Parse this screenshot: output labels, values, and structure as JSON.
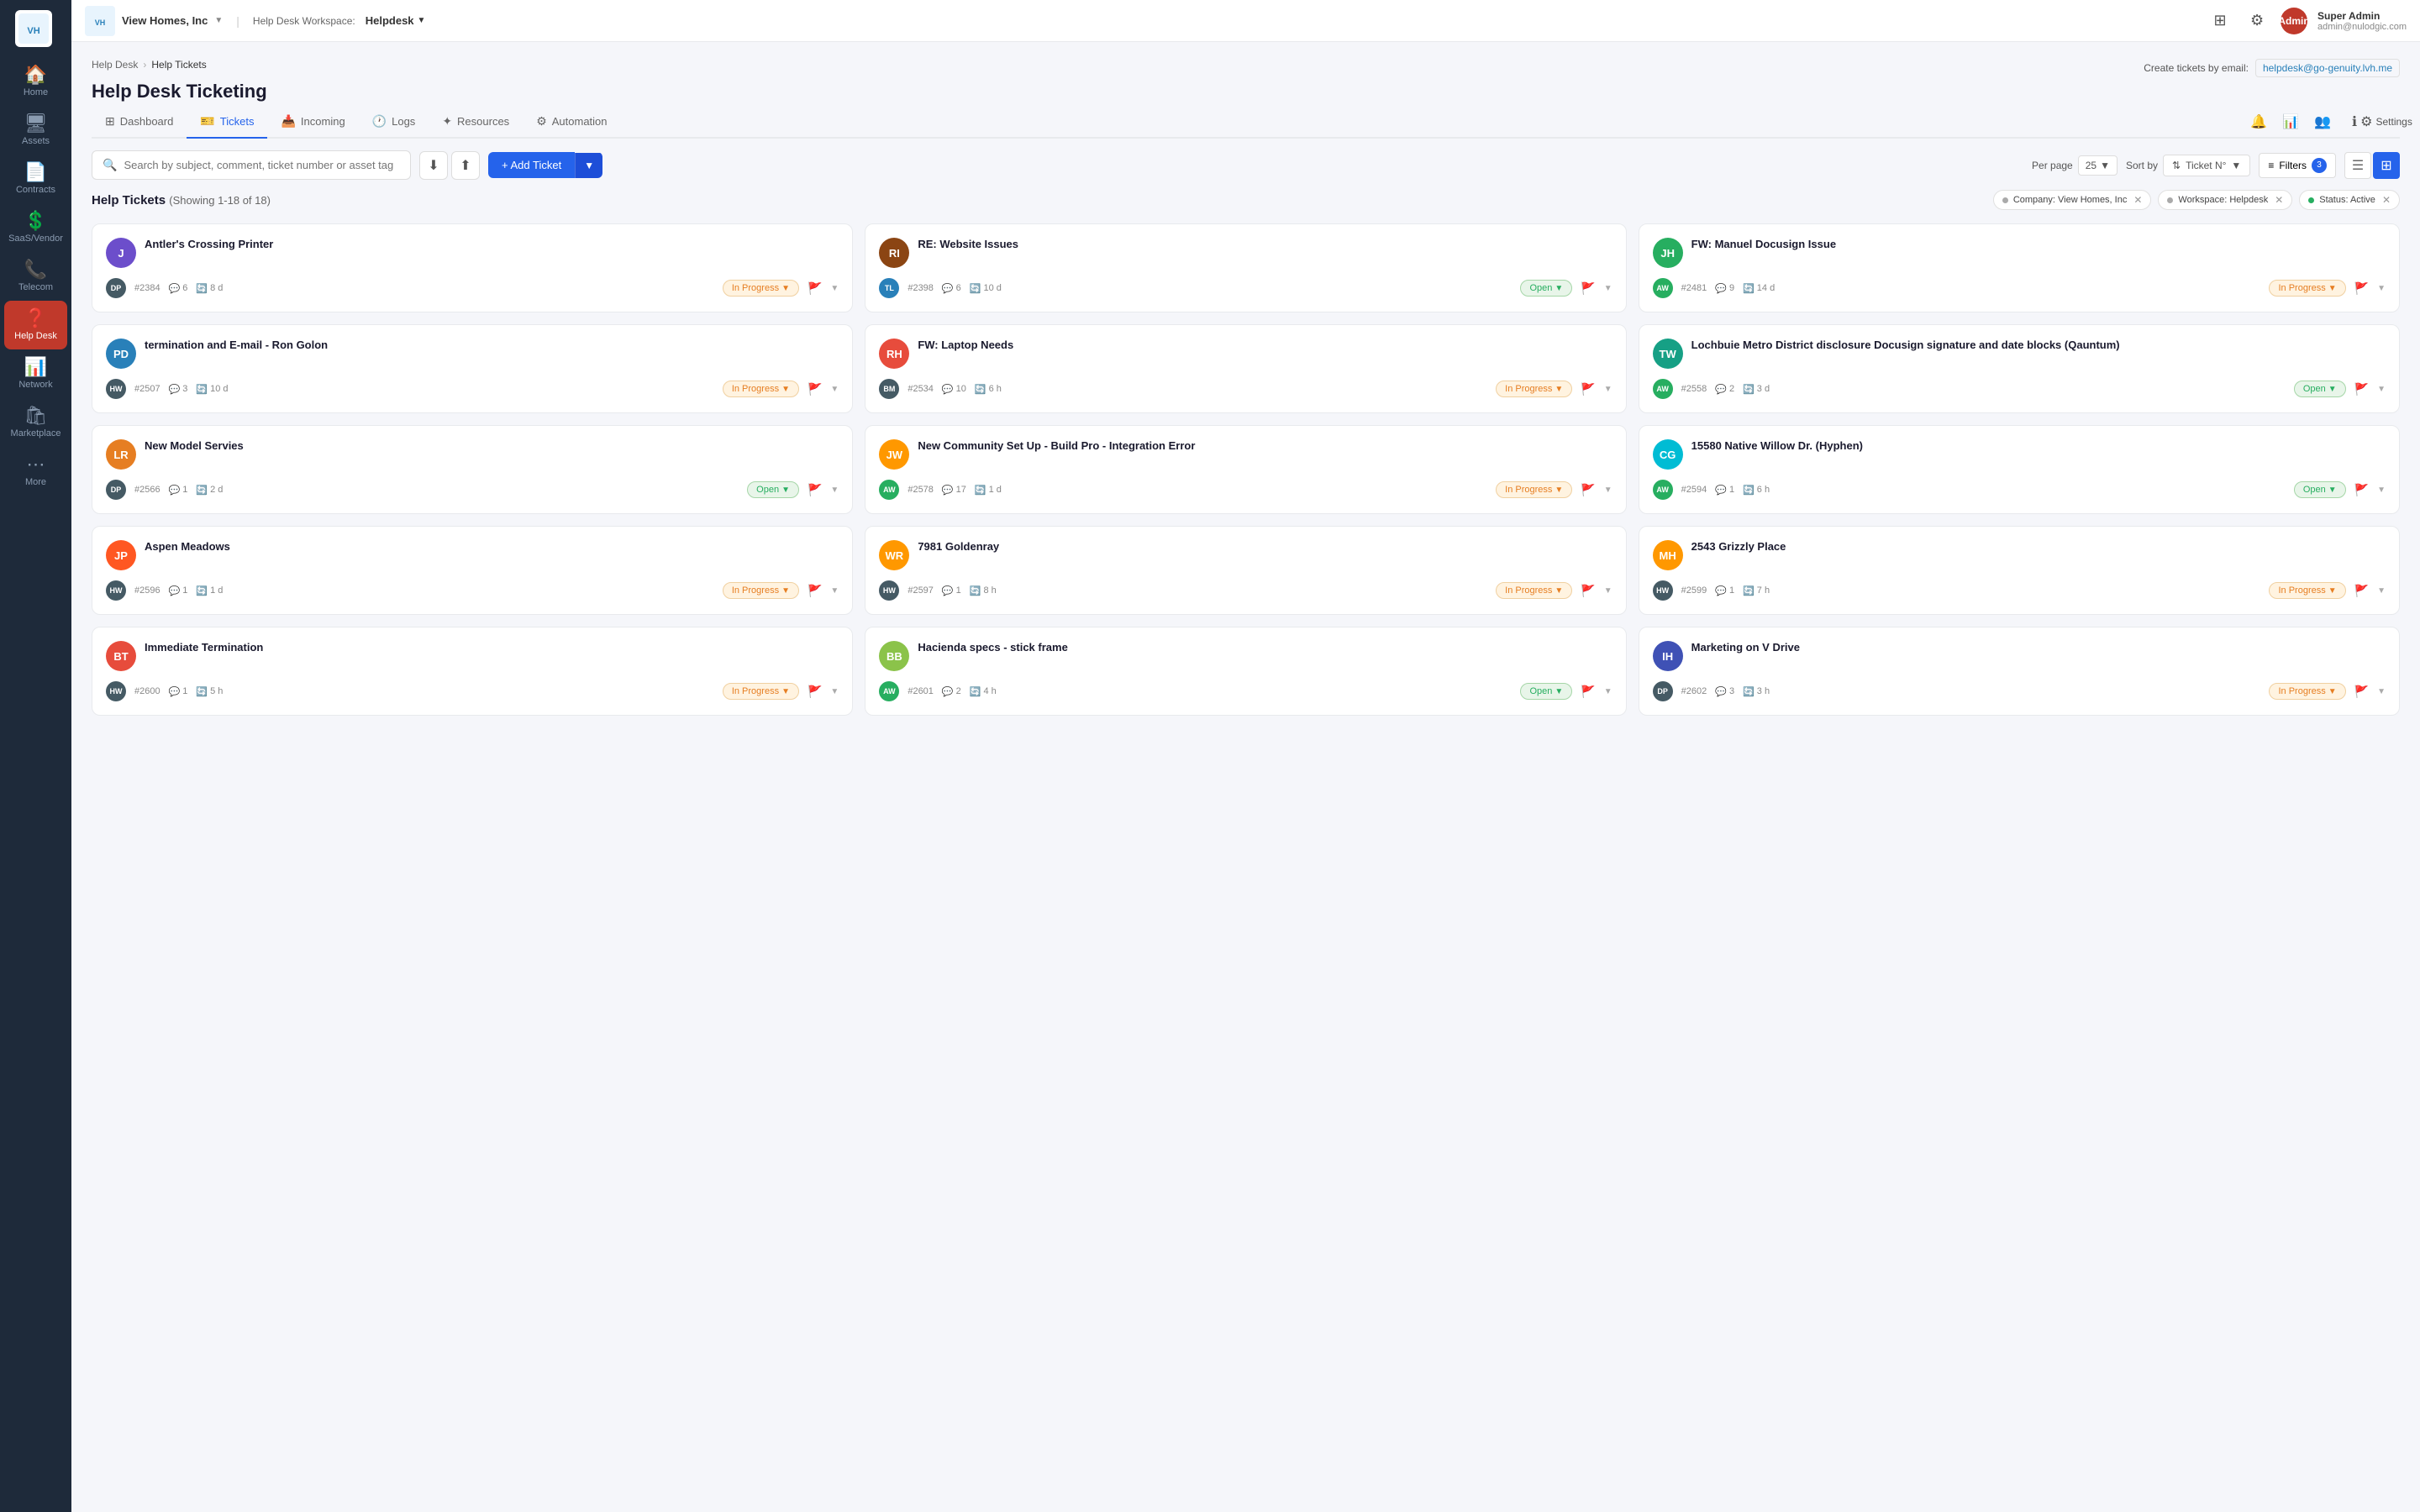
{
  "sidebar": {
    "items": [
      {
        "id": "home",
        "label": "Home",
        "icon": "🏠",
        "active": false
      },
      {
        "id": "assets",
        "label": "Assets",
        "icon": "🖥",
        "active": false
      },
      {
        "id": "contracts",
        "label": "Contracts",
        "icon": "📄",
        "active": false
      },
      {
        "id": "saas-vendor",
        "label": "SaaS/Vendor",
        "icon": "💲",
        "active": false
      },
      {
        "id": "telecom",
        "label": "Telecom",
        "icon": "📞",
        "active": false
      },
      {
        "id": "help-desk",
        "label": "Help Desk",
        "icon": "❓",
        "active": true
      },
      {
        "id": "network",
        "label": "Network",
        "icon": "📊",
        "active": false
      },
      {
        "id": "marketplace",
        "label": "Marketplace",
        "icon": "🛍",
        "active": false
      },
      {
        "id": "more",
        "label": "More",
        "icon": "⋯",
        "active": false
      }
    ]
  },
  "topbar": {
    "logo_text": "VH",
    "company": "View Homes, Inc",
    "workspace_label": "Help Desk Workspace:",
    "workspace_name": "Helpdesk",
    "user_name": "Super Admin",
    "user_email": "admin@nulodgic.com",
    "avatar_text": "Admin"
  },
  "breadcrumb": {
    "items": [
      "Help Desk",
      "Help Tickets"
    ]
  },
  "page": {
    "title": "Help Desk Ticketing",
    "email_label": "Create tickets by email:",
    "email_value": "helpdesk@go-genuity.lvh.me"
  },
  "tabs": [
    {
      "id": "dashboard",
      "label": "Dashboard",
      "icon": "⊞"
    },
    {
      "id": "tickets",
      "label": "Tickets",
      "icon": "🎫",
      "active": true
    },
    {
      "id": "incoming",
      "label": "Incoming",
      "icon": "📥"
    },
    {
      "id": "logs",
      "label": "Logs",
      "icon": "🕐"
    },
    {
      "id": "resources",
      "label": "Resources",
      "icon": "✦"
    },
    {
      "id": "automation",
      "label": "Automation",
      "icon": "⚙"
    }
  ],
  "tab_actions": [
    {
      "id": "notification",
      "icon": "🔔"
    },
    {
      "id": "chart",
      "icon": "📊"
    },
    {
      "id": "team",
      "icon": "👥"
    },
    {
      "id": "info",
      "icon": "ℹ"
    },
    {
      "id": "settings",
      "label": "Settings",
      "icon": "⚙"
    }
  ],
  "toolbar": {
    "search_placeholder": "Search by subject, comment, ticket number or asset tag",
    "per_page_label": "Per page",
    "per_page_value": "25",
    "sort_by_label": "Sort by",
    "sort_value": "Ticket N°",
    "filters_label": "Filters",
    "filters_count": "3",
    "add_ticket_label": "+ Add Ticket"
  },
  "filters_row": {
    "title": "Help Tickets",
    "count": "(Showing 1-18 of 18)",
    "active_filters": [
      {
        "id": "company",
        "label": "Company: View Homes, Inc"
      },
      {
        "id": "workspace",
        "label": "Workspace: Helpdesk"
      },
      {
        "id": "status",
        "label": "Status: Active"
      }
    ]
  },
  "tickets": [
    {
      "id": 1,
      "avatar_text": "J",
      "avatar_color": "av-purple",
      "title": "Antler's Crossing Printer",
      "assignee": "DP",
      "assignee_color": "assignee-dark",
      "ticket_num": "#2384",
      "comments": "6",
      "time": "8 d",
      "status": "In Progress",
      "status_class": "status-in-progress"
    },
    {
      "id": 2,
      "avatar_text": "RI",
      "avatar_color": "av-brown",
      "title": "RE: Website Issues",
      "assignee": "TL",
      "assignee_color": "assignee-blue",
      "ticket_num": "#2398",
      "comments": "6",
      "time": "10 d",
      "status": "Open",
      "status_class": "status-open"
    },
    {
      "id": 3,
      "avatar_text": "JH",
      "avatar_color": "av-green",
      "title": "FW: Manuel Docusign Issue",
      "assignee": "AW",
      "assignee_color": "assignee-green",
      "ticket_num": "#2481",
      "comments": "9",
      "time": "14 d",
      "status": "In Progress",
      "status_class": "status-in-progress"
    },
    {
      "id": 4,
      "avatar_text": "PD",
      "avatar_color": "av-blue",
      "title": "termination and E-mail - Ron Golon",
      "assignee": "HW",
      "assignee_color": "assignee-dark",
      "ticket_num": "#2507",
      "comments": "3",
      "time": "10 d",
      "status": "In Progress",
      "status_class": "status-in-progress"
    },
    {
      "id": 5,
      "avatar_text": "RH",
      "avatar_color": "av-red",
      "title": "FW: Laptop Needs",
      "assignee": "BM",
      "assignee_color": "assignee-dark",
      "ticket_num": "#2534",
      "comments": "10",
      "time": "6 h",
      "status": "In Progress",
      "status_class": "status-in-progress"
    },
    {
      "id": 6,
      "avatar_text": "TW",
      "avatar_color": "av-teal",
      "title": "Lochbuie Metro District disclosure Docusign signature and date blocks (Qauntum)",
      "assignee": "AW",
      "assignee_color": "assignee-green",
      "ticket_num": "#2558",
      "comments": "2",
      "time": "3 d",
      "status": "Open",
      "status_class": "status-open"
    },
    {
      "id": 7,
      "avatar_text": "LR",
      "avatar_color": "av-orange",
      "title": "New Model Servies",
      "assignee": "DP",
      "assignee_color": "assignee-dark",
      "ticket_num": "#2566",
      "comments": "1",
      "time": "2 d",
      "status": "Open",
      "status_class": "status-open"
    },
    {
      "id": 8,
      "avatar_text": "JW",
      "avatar_color": "av-amber",
      "title": "New Community Set Up - Build Pro - Integration Error",
      "assignee": "AW",
      "assignee_color": "assignee-green",
      "ticket_num": "#2578",
      "comments": "17",
      "time": "1 d",
      "status": "In Progress",
      "status_class": "status-in-progress"
    },
    {
      "id": 9,
      "avatar_text": "CG",
      "avatar_color": "av-cyan",
      "title": "15580 Native Willow Dr. (Hyphen)",
      "assignee": "AW",
      "assignee_color": "assignee-green",
      "ticket_num": "#2594",
      "comments": "1",
      "time": "6 h",
      "status": "Open",
      "status_class": "status-open"
    },
    {
      "id": 10,
      "avatar_text": "JP",
      "avatar_color": "av-deep-orange",
      "title": "Aspen Meadows",
      "assignee": "HW",
      "assignee_color": "assignee-dark",
      "ticket_num": "#2596",
      "comments": "1",
      "time": "1 d",
      "status": "In Progress",
      "status_class": "status-in-progress"
    },
    {
      "id": 11,
      "avatar_text": "WR",
      "avatar_color": "av-amber",
      "title": "7981 Goldenray",
      "assignee": "HW",
      "assignee_color": "assignee-dark",
      "ticket_num": "#2597",
      "comments": "1",
      "time": "8 h",
      "status": "In Progress",
      "status_class": "status-in-progress"
    },
    {
      "id": 12,
      "avatar_text": "MH",
      "avatar_color": "av-amber",
      "title": "2543 Grizzly Place",
      "assignee": "HW",
      "assignee_color": "assignee-dark",
      "ticket_num": "#2599",
      "comments": "1",
      "time": "7 h",
      "status": "In Progress",
      "status_class": "status-in-progress"
    },
    {
      "id": 13,
      "avatar_text": "BT",
      "avatar_color": "av-red",
      "title": "Immediate Termination",
      "assignee": "HW",
      "assignee_color": "assignee-dark",
      "ticket_num": "#2600",
      "comments": "1",
      "time": "5 h",
      "status": "In Progress",
      "status_class": "status-in-progress"
    },
    {
      "id": 14,
      "avatar_text": "BB",
      "avatar_color": "av-lime",
      "title": "Hacienda specs - stick frame",
      "assignee": "AW",
      "assignee_color": "assignee-green",
      "ticket_num": "#2601",
      "comments": "2",
      "time": "4 h",
      "status": "Open",
      "status_class": "status-open"
    },
    {
      "id": 15,
      "avatar_text": "IH",
      "avatar_color": "av-indigo",
      "title": "Marketing on V Drive",
      "assignee": "DP",
      "assignee_color": "assignee-dark",
      "ticket_num": "#2602",
      "comments": "3",
      "time": "3 h",
      "status": "In Progress",
      "status_class": "status-in-progress"
    }
  ]
}
